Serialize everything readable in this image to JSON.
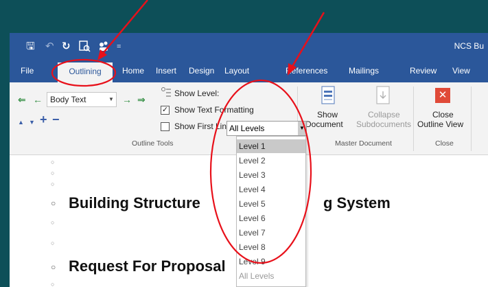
{
  "titlebar": {
    "doc_title": "NCS Bu",
    "save_glyph": "🖫",
    "undo_glyph": "↶",
    "redo_glyph": "↻",
    "dropdown_glyph": "="
  },
  "tabs": {
    "file": "File",
    "outlining": "Outlining",
    "home": "Home",
    "insert": "Insert",
    "design": "Design",
    "layout": "Layout",
    "references": "References",
    "mailings": "Mailings",
    "review": "Review",
    "view": "View"
  },
  "outline_tools": {
    "promote_heading_glyph": "⇐",
    "promote_glyph": "←",
    "demote_glyph": "→",
    "demote_body_glyph": "⇒",
    "move_up_glyph": "▲",
    "move_down_glyph": "▼",
    "expand_glyph": "+",
    "collapse_glyph": "−",
    "level_value": "Body Text",
    "show_level_label": "Show Level:",
    "show_text_formatting_label": "Show Text Formatting",
    "show_text_formatting_checked": true,
    "show_first_line_label": "Show First Line Only",
    "show_first_line_checked": false,
    "checkmark": "✓",
    "group_label": "Outline Tools"
  },
  "master_document": {
    "show_document_line1": "Show",
    "show_document_line2": "Document",
    "collapse_line1": "Collapse",
    "collapse_line2": "Subdocuments",
    "group_label": "Master Document"
  },
  "close": {
    "close_line1": "Close",
    "close_line2": "Outline View",
    "close_glyph": "✕",
    "group_label": "Close"
  },
  "show_level_dropdown": {
    "selected": "All Levels",
    "options": [
      "Level 1",
      "Level 2",
      "Level 3",
      "Level 4",
      "Level 5",
      "Level 6",
      "Level 7",
      "Level 8",
      "Level 9",
      "All Levels"
    ],
    "highlighted_index": 0
  },
  "document": {
    "bullet_glyph": "○",
    "heading1": "Building Structure",
    "heading1_tail": "g System",
    "heading2": "Request For Proposal"
  },
  "colors": {
    "ribbon_blue": "#2b579a",
    "annotation_red": "#e8101a",
    "background_teal": "#0d4f58",
    "close_red": "#e04a38"
  }
}
